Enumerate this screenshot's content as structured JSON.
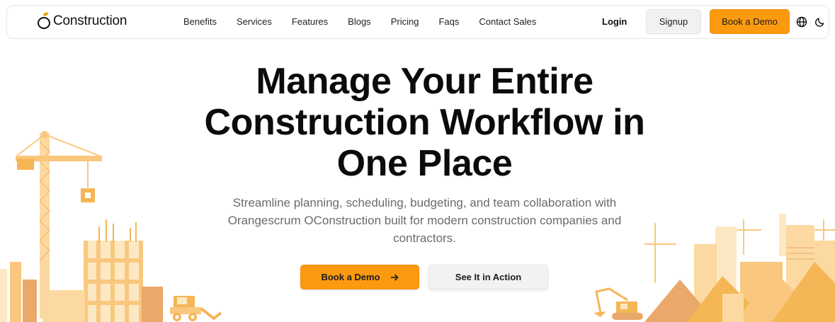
{
  "brand": {
    "name": "Construction",
    "accent_color": "#fb9a0e"
  },
  "nav": {
    "items": [
      {
        "label": "Benefits"
      },
      {
        "label": "Services"
      },
      {
        "label": "Features"
      },
      {
        "label": "Blogs"
      },
      {
        "label": "Pricing"
      },
      {
        "label": "Faqs"
      },
      {
        "label": "Contact Sales"
      }
    ],
    "login_label": "Login",
    "signup_label": "Signup",
    "book_demo_label": "Book a Demo",
    "language_icon": "globe-icon",
    "theme_icon": "moon-icon"
  },
  "hero": {
    "title_line1": "Manage Your Entire",
    "title_line2": "Construction Workflow in",
    "title_line3": "One Place",
    "subtitle": "Streamline planning, scheduling, budgeting, and team collaboration with Orangescrum OConstruction built for modern construction companies and contractors.",
    "primary_cta": "Book a Demo",
    "primary_cta_icon": "arrow-right-icon",
    "secondary_cta": "See It in Action"
  },
  "illustration": {
    "left": "construction-crane-buildings-bulldozer",
    "right": "city-skyline-cranes-excavator",
    "colors": [
      "#fcd9a1",
      "#f9c77e",
      "#f5b656",
      "#eaa86a",
      "#fde8c4"
    ]
  }
}
